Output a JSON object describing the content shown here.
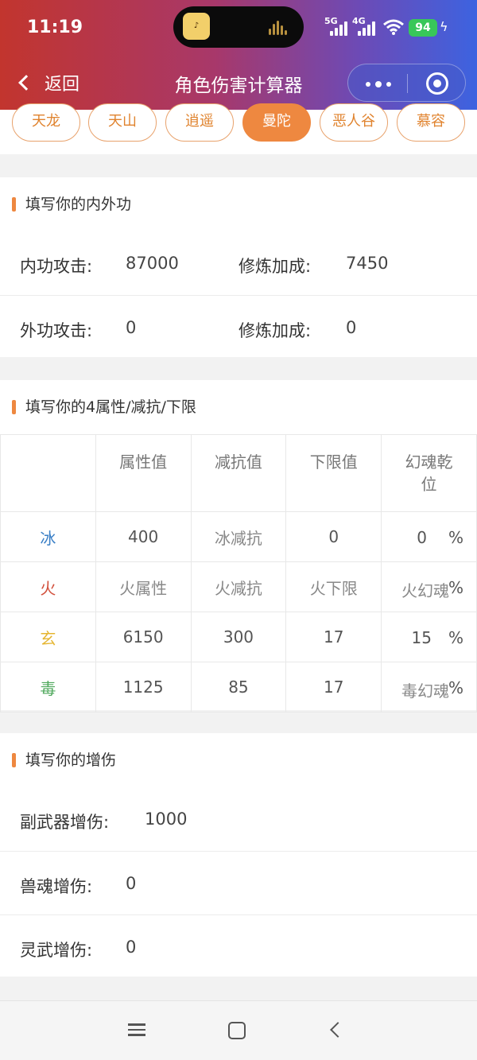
{
  "status_bar": {
    "time": "11:19",
    "signal1": "5G",
    "signal2": "4G",
    "battery": "94"
  },
  "nav": {
    "back_label": "返回",
    "title": "角色伤害计算器"
  },
  "tabs": [
    {
      "label": "天龙",
      "active": false
    },
    {
      "label": "天山",
      "active": false
    },
    {
      "label": "逍遥",
      "active": false
    },
    {
      "label": "曼陀",
      "active": true
    },
    {
      "label": "恶人谷",
      "active": false
    },
    {
      "label": "慕容",
      "active": false
    }
  ],
  "attack": {
    "title": "填写你的内外功",
    "inner_label": "内功攻击:",
    "inner_value": "87000",
    "inner_cult_label": "修炼加成:",
    "inner_cult_value": "7450",
    "outer_label": "外功攻击:",
    "outer_value": "0",
    "outer_cult_label": "修炼加成:",
    "outer_cult_value": "0"
  },
  "attributes": {
    "title": "填写你的4属性/减抗/下限",
    "headers": [
      "",
      "属性值",
      "减抗值",
      "下限值",
      "幻魂乾位"
    ],
    "rows": [
      {
        "element": "冰",
        "value": "400",
        "reduce": "冰减抗",
        "floor": "0",
        "soul": "0",
        "pct": "%"
      },
      {
        "element": "火",
        "value": "火属性",
        "reduce": "火减抗",
        "floor": "火下限",
        "soul": "火幻魂",
        "pct": "%"
      },
      {
        "element": "玄",
        "value": "6150",
        "reduce": "300",
        "floor": "17",
        "soul": "15",
        "pct": "%"
      },
      {
        "element": "毒",
        "value": "1125",
        "reduce": "85",
        "floor": "17",
        "soul": "毒幻魂",
        "pct": "%"
      }
    ]
  },
  "boost": {
    "title": "填写你的增伤",
    "weapon_label": "副武器增伤:",
    "weapon_value": "1000",
    "beast_label": "兽魂增伤:",
    "beast_value": "0",
    "spirit_label": "灵武增伤:",
    "spirit_value": "0"
  },
  "colors": {
    "accent": "#ee8840",
    "ice": "#3a7fc6",
    "fire": "#d2503c",
    "xuan": "#e5b530",
    "poison": "#4fa85c"
  }
}
